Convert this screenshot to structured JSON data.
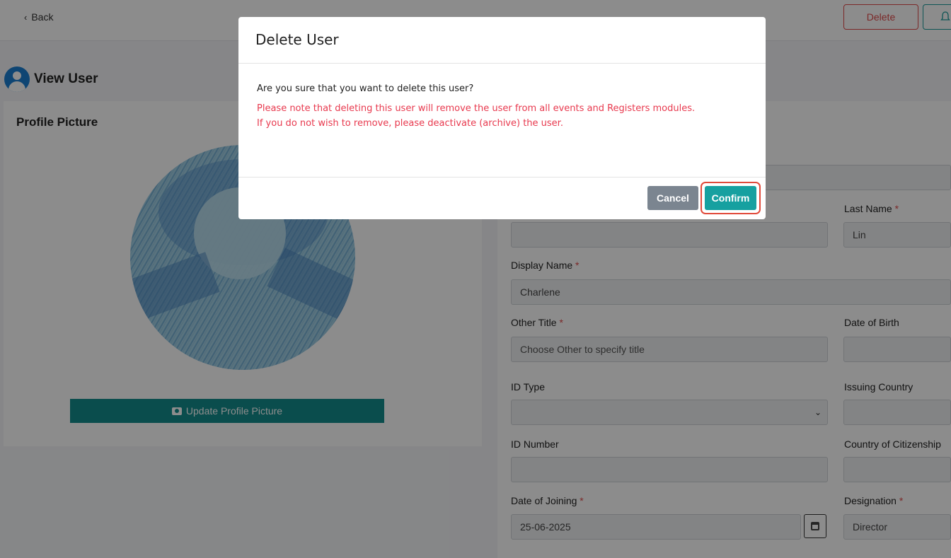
{
  "topbar": {
    "back_label": "Back",
    "delete_label": "Delete"
  },
  "page": {
    "title": "View User"
  },
  "profile": {
    "heading": "Profile Picture",
    "update_button_label": "Update Profile Picture"
  },
  "form": {
    "last_name": {
      "label": "Last Name",
      "value": "Lin"
    },
    "display_name": {
      "label": "Display Name",
      "value": "Charlene"
    },
    "other_title": {
      "label": "Other Title",
      "placeholder": "Choose Other to specify title"
    },
    "date_of_birth": {
      "label": "Date of Birth",
      "value": ""
    },
    "id_type": {
      "label": "ID Type",
      "value": ""
    },
    "issuing_country": {
      "label": "Issuing Country",
      "value": ""
    },
    "id_number": {
      "label": "ID Number",
      "value": ""
    },
    "country_of_citizenship": {
      "label": "Country of Citizenship",
      "value": ""
    },
    "date_of_joining": {
      "label": "Date of Joining",
      "value": "25-06-2025"
    },
    "designation": {
      "label": "Designation",
      "value": "Director"
    },
    "required_marker": "*"
  },
  "modal": {
    "title": "Delete User",
    "question": "Are you sure that you want to delete this user?",
    "warning_line1": "Please note that deleting this user will remove the user from all events and Registers modules.",
    "warning_line2": "If you do not wish to remove, please deactivate (archive) the user.",
    "cancel_label": "Cancel",
    "confirm_label": "Confirm"
  },
  "colors": {
    "accent": "#138d8d",
    "danger": "#e04b4b",
    "warning_text": "#e8394e",
    "highlight_ring": "#e14a3b"
  }
}
